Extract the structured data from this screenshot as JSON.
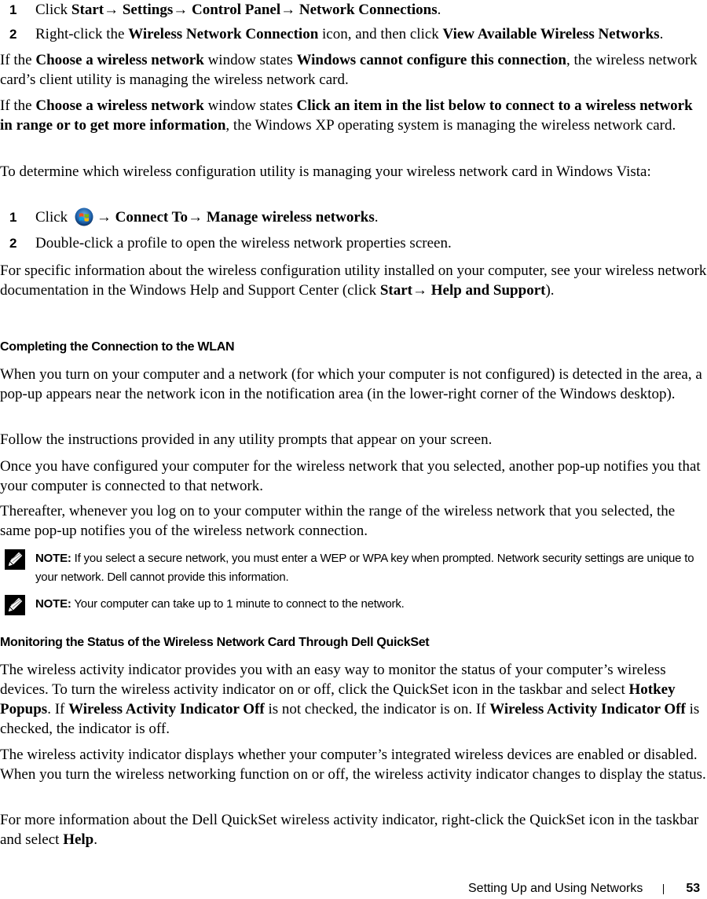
{
  "steps_xp": [
    {
      "num": "1",
      "pre": "Click ",
      "start": "Start",
      "arrow1": "→ ",
      "settings": "Settings",
      "arrow2": "→ ",
      "cp": "Control Panel",
      "arrow3": "→ ",
      "nc": "Network Connections",
      "post": "."
    },
    {
      "num": "2",
      "pre": "Right-click the ",
      "wnc": "Wireless Network Connection",
      "mid": " icon, and then click ",
      "vawn": "View Available Wireless Networks",
      "post": "."
    }
  ],
  "para1": {
    "pre": "If the ",
    "b1": "Choose a wireless network",
    "mid": " window states ",
    "b2": "Windows cannot configure this connection",
    "post": ", the wireless network card’s client utility is managing the wireless network card."
  },
  "para2": {
    "pre": "If the ",
    "b1": "Choose a wireless network",
    "mid": " window states ",
    "b2": "Click an item in the list below to connect to a wireless network in range or to get more information",
    "post": ", the Windows XP operating system is managing the wireless network card."
  },
  "para3": "To determine which wireless configuration utility is managing your wireless network card in Windows Vista:",
  "steps_vista": [
    {
      "num": "1",
      "pre": "Click ",
      "icon": "windows-start-icon",
      "arrow1": "→ ",
      "ct": "Connect To",
      "arrow2": "→ ",
      "mwn": "Manage wireless networks",
      "post": "."
    },
    {
      "num": "2",
      "text": "Double-click a profile to open the wireless network properties screen."
    }
  ],
  "para4": {
    "pre": "For specific information about the wireless configuration utility installed on your computer, see your wireless network documentation in the Windows Help and Support Center (click ",
    "b1": "Start",
    "arrow": "→ ",
    "b2": "Help and Support",
    "post": ")."
  },
  "heading1": "Completing the Connection to the WLAN",
  "para5": "When you turn on your computer and a network (for which your computer is not configured) is detected in the area, a pop-up appears near the network icon in the notification area (in the lower-right corner of the Windows desktop).",
  "para6": "Follow the instructions provided in any utility prompts that appear on your screen.",
  "para7": "Once you have configured your computer for the wireless network that you selected, another pop-up notifies you that your computer is connected to that network.",
  "para8": "Thereafter, whenever you log on to your computer within the range of the wireless network that you selected, the same pop-up notifies you of the wireless network connection.",
  "note1": {
    "label": "NOTE:",
    "text": " If you select a secure network, you must enter a WEP or WPA key when prompted. Network security settings are unique to your network. Dell cannot provide this information."
  },
  "note2": {
    "label": "NOTE:",
    "text": " Your computer can take up to 1 minute to connect to the network."
  },
  "heading2": "Monitoring the Status of the Wireless Network Card Through Dell QuickSet",
  "para9": {
    "pre": "The wireless activity indicator provides you with an easy way to monitor the status of your computer’s wireless devices. To turn the wireless activity indicator on or off, click the QuickSet icon in the taskbar and select ",
    "b1": "Hotkey Popups",
    "mid1": ". If ",
    "b2": "Wireless Activity Indicator Off",
    "mid2": " is not checked, the indicator is on. If ",
    "b3": "Wireless Activity Indicator Off",
    "post": " is checked, the indicator is off."
  },
  "para10": "The wireless activity indicator displays whether your computer’s integrated wireless devices are enabled or disabled. When you turn the wireless networking function on or off, the wireless activity indicator changes to display the status.",
  "para11": {
    "pre": "For more information about the Dell QuickSet wireless activity indicator, right-click the QuickSet icon in the taskbar and select ",
    "b1": "Help",
    "post": "."
  },
  "footer": {
    "section": "Setting Up and Using Networks",
    "page": "53"
  }
}
